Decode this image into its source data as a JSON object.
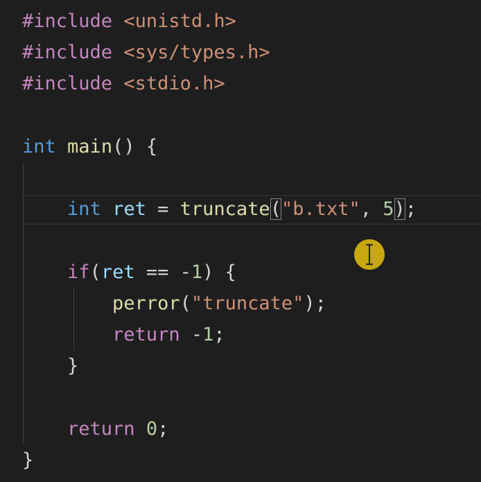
{
  "editor": {
    "language": "c",
    "lines": [
      {
        "tokens": [
          {
            "t": "#include",
            "c": "pre"
          },
          {
            "t": " ",
            "c": "pun"
          },
          {
            "t": "<unistd.h>",
            "c": "hdr"
          }
        ]
      },
      {
        "tokens": [
          {
            "t": "#include",
            "c": "pre"
          },
          {
            "t": " ",
            "c": "pun"
          },
          {
            "t": "<sys/types.h>",
            "c": "hdr"
          }
        ]
      },
      {
        "tokens": [
          {
            "t": "#include",
            "c": "pre"
          },
          {
            "t": " ",
            "c": "pun"
          },
          {
            "t": "<stdio.h>",
            "c": "hdr"
          }
        ]
      },
      {
        "tokens": []
      },
      {
        "tokens": [
          {
            "t": "int",
            "c": "kw"
          },
          {
            "t": " ",
            "c": "pun"
          },
          {
            "t": "main",
            "c": "fn"
          },
          {
            "t": "() {",
            "c": "pun"
          }
        ]
      },
      {
        "tokens": []
      },
      {
        "tokens": [
          {
            "t": "    ",
            "c": "pun"
          },
          {
            "t": "int",
            "c": "kw"
          },
          {
            "t": " ",
            "c": "pun"
          },
          {
            "t": "ret",
            "c": "var"
          },
          {
            "t": " = ",
            "c": "pun"
          },
          {
            "t": "truncate",
            "c": "fn"
          },
          {
            "t": "(",
            "c": "pun",
            "match": true
          },
          {
            "t": "\"b.txt\"",
            "c": "str"
          },
          {
            "t": ", ",
            "c": "pun"
          },
          {
            "t": "5",
            "c": "num"
          },
          {
            "t": ")",
            "c": "pun",
            "match": true
          },
          {
            "t": ";",
            "c": "pun"
          }
        ]
      },
      {
        "tokens": []
      },
      {
        "tokens": [
          {
            "t": "    ",
            "c": "pun"
          },
          {
            "t": "if",
            "c": "ctl"
          },
          {
            "t": "(",
            "c": "pun"
          },
          {
            "t": "ret",
            "c": "var"
          },
          {
            "t": " == -",
            "c": "pun"
          },
          {
            "t": "1",
            "c": "num"
          },
          {
            "t": ") {",
            "c": "pun"
          }
        ]
      },
      {
        "tokens": [
          {
            "t": "        ",
            "c": "pun"
          },
          {
            "t": "perror",
            "c": "fn"
          },
          {
            "t": "(",
            "c": "pun"
          },
          {
            "t": "\"truncate\"",
            "c": "str"
          },
          {
            "t": ");",
            "c": "pun"
          }
        ]
      },
      {
        "tokens": [
          {
            "t": "        ",
            "c": "pun"
          },
          {
            "t": "return",
            "c": "ctl"
          },
          {
            "t": " -",
            "c": "pun"
          },
          {
            "t": "1",
            "c": "num"
          },
          {
            "t": ";",
            "c": "pun"
          }
        ]
      },
      {
        "tokens": [
          {
            "t": "    }",
            "c": "pun"
          }
        ]
      },
      {
        "tokens": []
      },
      {
        "tokens": [
          {
            "t": "    ",
            "c": "pun"
          },
          {
            "t": "return",
            "c": "ctl"
          },
          {
            "t": " ",
            "c": "pun"
          },
          {
            "t": "0",
            "c": "num"
          },
          {
            "t": ";",
            "c": "pun"
          }
        ]
      },
      {
        "tokens": [
          {
            "t": "}",
            "c": "pun"
          }
        ]
      }
    ]
  },
  "colors": {
    "background": "#1e1e1e",
    "preprocessor": "#c586c0",
    "header": "#ce9178",
    "keyword": "#569cd6",
    "control": "#c586c0",
    "function": "#dcdcaa",
    "variable": "#9cdcfe",
    "string": "#ce9178",
    "number": "#b5cea8",
    "punctuation": "#d4d4d4",
    "cursor_highlight": "#d8b40e"
  },
  "icons": {
    "mouse_cursor": "ibeam-cursor-icon"
  }
}
